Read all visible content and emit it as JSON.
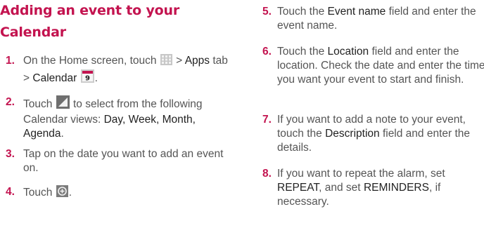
{
  "heading": {
    "line1": "Adding an event to your",
    "line2": "Calendar"
  },
  "left_steps": [
    {
      "num": "1.",
      "parts": [
        "On the Home screen, touch",
        ">",
        "Apps",
        "tab >",
        "Calendar",
        "."
      ],
      "icons": [
        "apps-grid-icon",
        "calendar-icon"
      ],
      "calendar_icon_day": "9"
    },
    {
      "num": "2.",
      "parts": [
        "Touch",
        "to select from the following Calendar views:",
        "Day, Week, Month, Agenda",
        "."
      ],
      "icons": [
        "view-select-icon"
      ]
    },
    {
      "num": "3.",
      "parts": [
        "Tap on the date you want to add an event on."
      ]
    },
    {
      "num": "4.",
      "parts": [
        "Touch",
        "."
      ],
      "icons": [
        "add-event-icon"
      ]
    }
  ],
  "right_steps": [
    {
      "num": "5.",
      "parts": [
        "Touch the",
        "Event name",
        "field and enter the event name."
      ]
    },
    {
      "num": "6.",
      "parts": [
        "Touch the",
        "Location",
        "field and enter the location. Check the date and enter the time you want your event to start and finish."
      ]
    },
    {
      "num": "7.",
      "parts": [
        "If you want to add a note to your event, touch the",
        "Description",
        "field and enter the details."
      ]
    },
    {
      "num": "8.",
      "parts": [
        "If you want to repeat the alarm, set",
        "REPEAT",
        ", and set",
        "REMINDERS",
        ", if necessary."
      ]
    }
  ],
  "colors": {
    "accent": "#c3134f",
    "body_text": "#555555",
    "bold_text": "#222222"
  }
}
